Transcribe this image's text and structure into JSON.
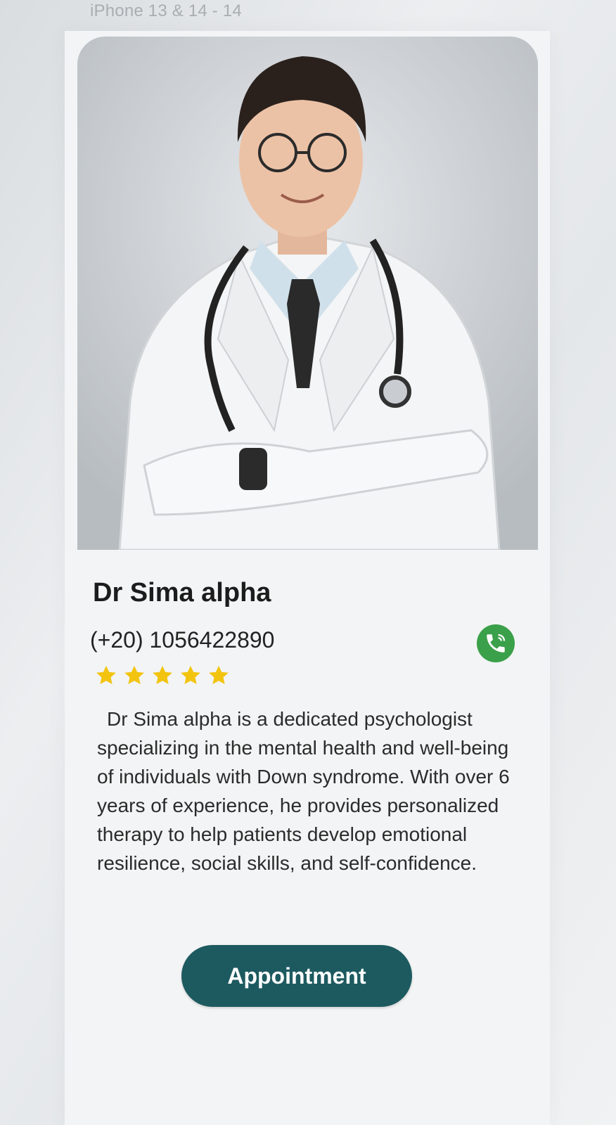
{
  "frame": {
    "label": "iPhone 13 & 14 - 14"
  },
  "doctor": {
    "name": "Dr Sima alpha",
    "phone": "(+20) 1056422890",
    "rating": 5,
    "rating_max": 5,
    "bio": "Dr Sima alpha is a dedicated psychologist specializing in the mental health and well-being of individuals with Down syndrome. With over 6 years of experience, he provides personalized therapy to help patients develop emotional resilience, social skills, and self-confidence."
  },
  "actions": {
    "appointment_label": "Appointment"
  },
  "icons": {
    "call": "phone-call-icon",
    "star": "star-icon"
  },
  "colors": {
    "accent": "#1d5a60",
    "call_green": "#3aa04a",
    "star": "#f2c40f"
  }
}
